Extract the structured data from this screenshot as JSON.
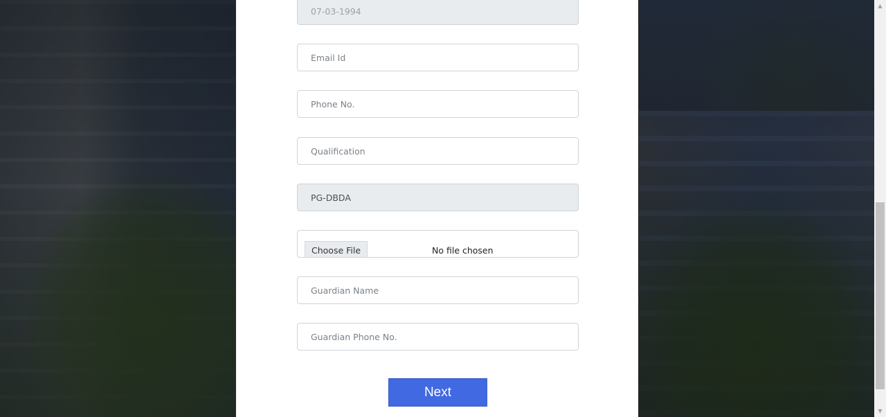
{
  "form": {
    "dob": {
      "value": "07-03-1994"
    },
    "email": {
      "placeholder": "Email Id"
    },
    "phone": {
      "placeholder": "Phone No."
    },
    "qualification": {
      "placeholder": "Qualification"
    },
    "course": {
      "value": "PG-DBDA"
    },
    "upload": {
      "button_label": "Choose File",
      "status": "No file chosen"
    },
    "guardian_name": {
      "placeholder": "Guardian Name"
    },
    "guardian_phone": {
      "placeholder": "Guardian Phone No."
    },
    "next_label": "Next"
  },
  "colors": {
    "accent": "#4169e1",
    "readonly_bg": "#e9ecef",
    "border": "#ced4da"
  },
  "scrollbar": {
    "up_icon": "triangle-up",
    "down_icon": "triangle-down"
  }
}
